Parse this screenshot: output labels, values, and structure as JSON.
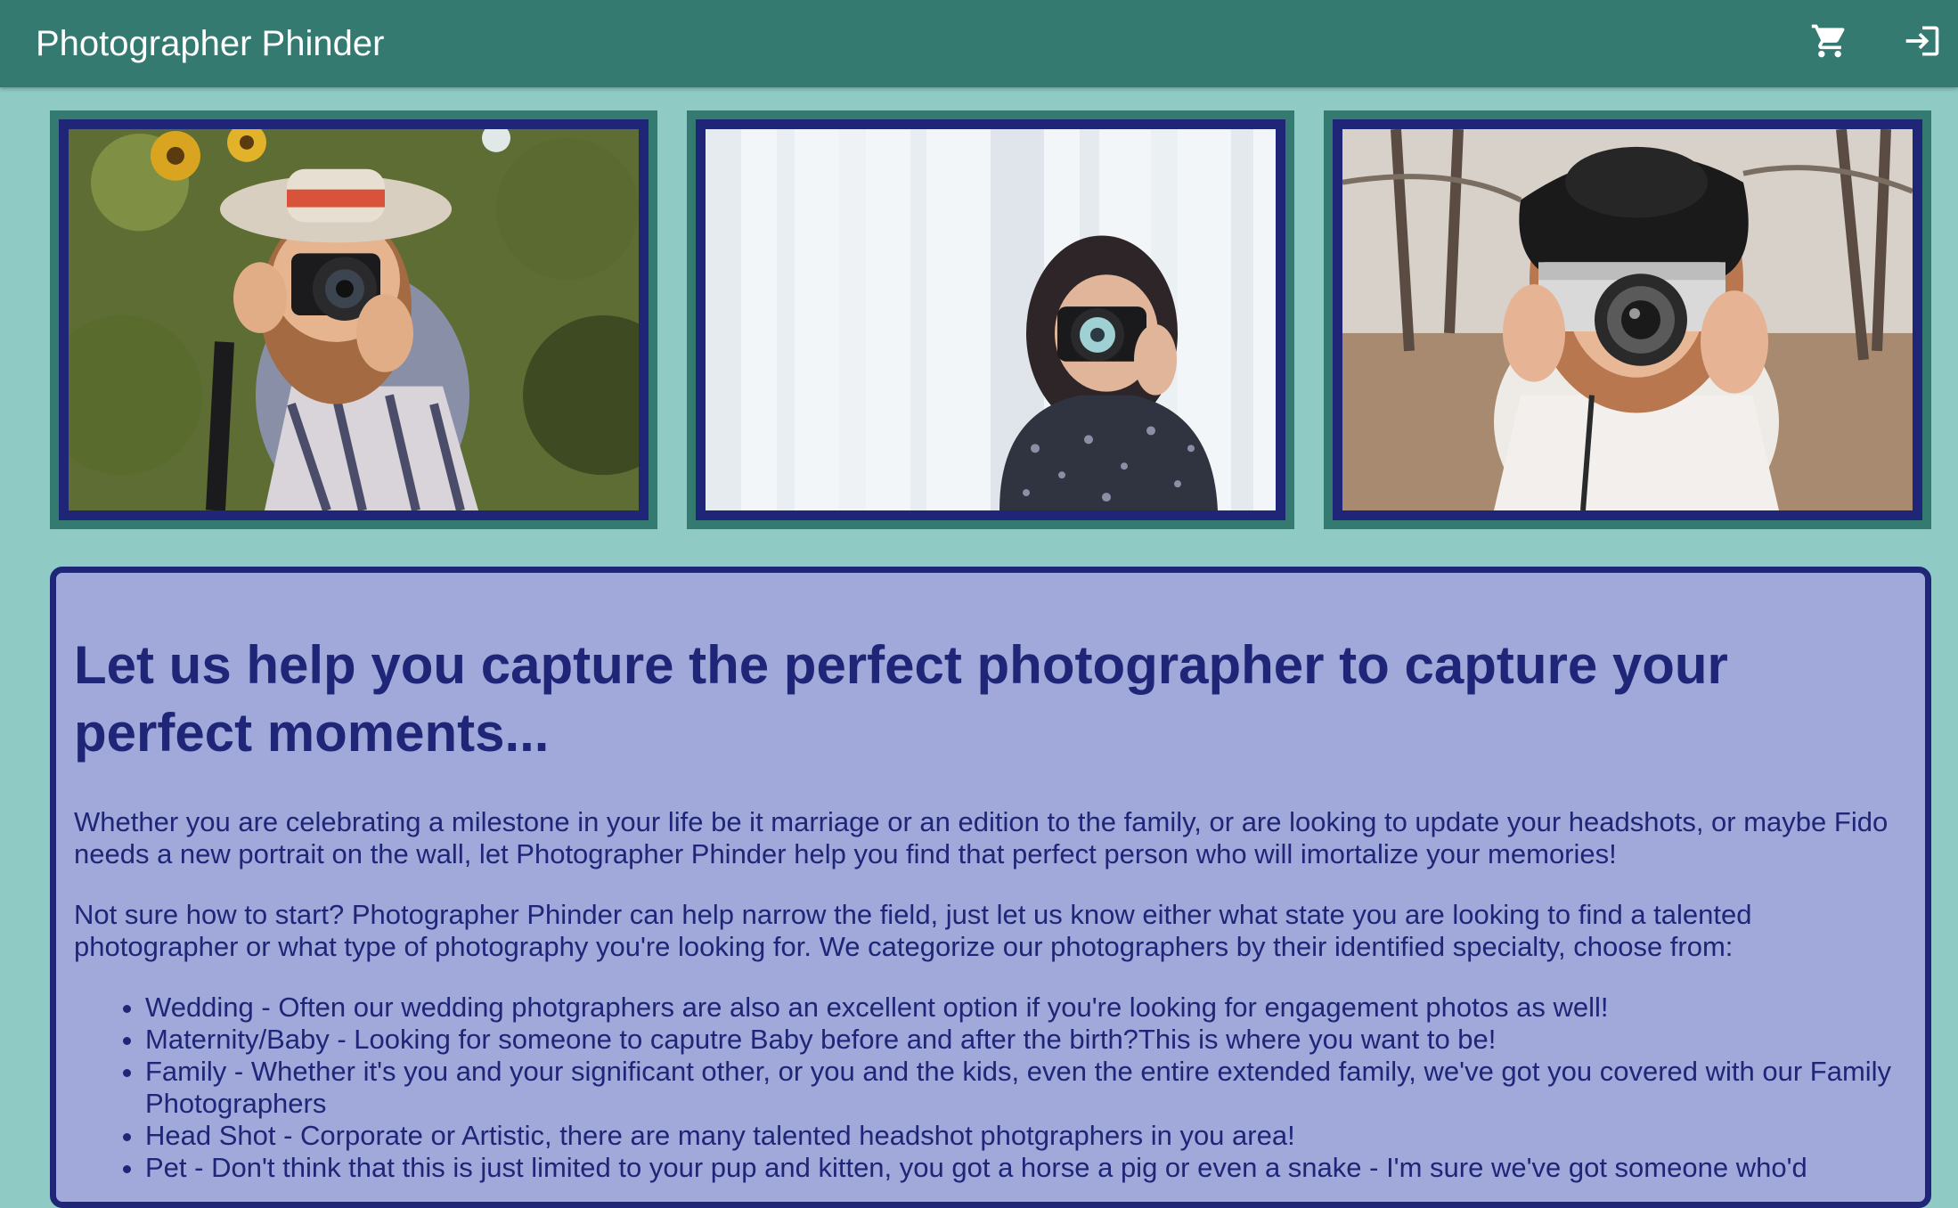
{
  "appbar": {
    "title": "Photographer Phinder",
    "cart_icon": "cart-icon",
    "login_icon": "login-icon"
  },
  "colors": {
    "appbar": "#357a70",
    "page_bg": "#8fcac4",
    "card_bg": "#a1a8da",
    "accent": "#1f2577"
  },
  "gallery": {
    "photos": [
      {
        "subject": "woman in hat with camera among sunflowers"
      },
      {
        "subject": "woman with camera in front of white curtains"
      },
      {
        "subject": "woman in black hat with vintage camera"
      }
    ]
  },
  "content": {
    "headline": "Let us help you capture the perfect photographer to capture your perfect moments...",
    "paragraph1": "Whether you are celebrating a milestone in your life be it marriage or an edition to the family, or are looking to update your headshots, or maybe Fido needs a new portrait on the wall, let Photographer Phinder help you find that perfect person who will imortalize your memories!",
    "paragraph2": "Not sure how to start? Photographer Phinder can help narrow the field, just let us know either what state you are looking to find a talented photographer or what type of photography you're looking for. We categorize our photographers by their identified specialty, choose from:",
    "specialties": [
      "Wedding - Often our wedding photgraphers are also an excellent option if you're looking for engagement photos as well!",
      "Maternity/Baby - Looking for someone to caputre Baby before and after the birth?This is where you want to be!",
      "Family - Whether it's you and your significant other, or you and the kids, even the entire extended family, we've got you covered with our Family Photographers",
      "Head Shot - Corporate or Artistic, there are many talented headshot photgraphers in you area!",
      "Pet - Don't think that this is just limited to your pup and kitten, you got a horse a pig or even a snake - I'm sure we've got someone who'd"
    ]
  }
}
